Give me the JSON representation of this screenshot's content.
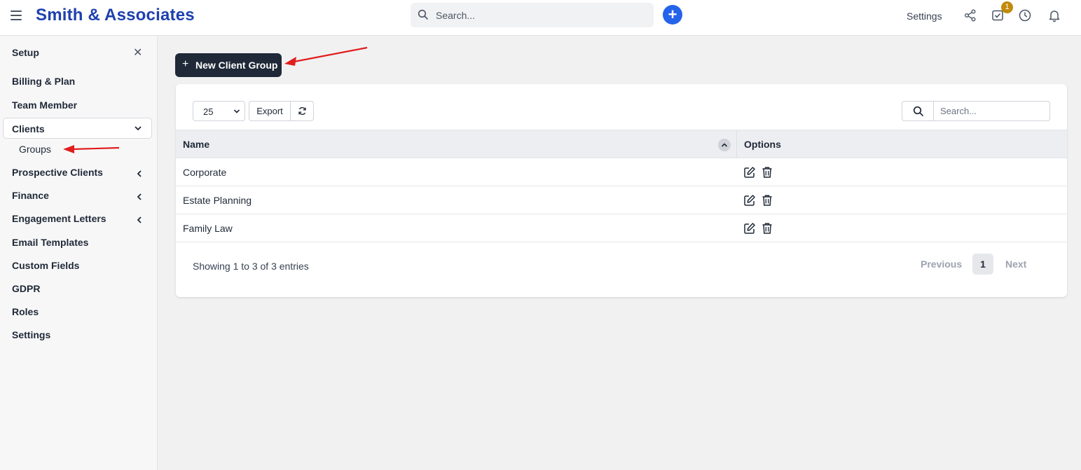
{
  "header": {
    "brand": "Smith & Associates",
    "search_placeholder": "Search...",
    "settings_label": "Settings",
    "tasks_badge": "1"
  },
  "sidebar": {
    "title": "Setup",
    "items": [
      {
        "label": "Billing & Plan"
      },
      {
        "label": "Team Member"
      },
      {
        "label": "Clients",
        "expanded": true
      },
      {
        "label": "Groups",
        "sub": true
      },
      {
        "label": "Prospective Clients"
      },
      {
        "label": "Finance"
      },
      {
        "label": "Engagement Letters"
      },
      {
        "label": "Email Templates"
      },
      {
        "label": "Custom Fields"
      },
      {
        "label": "GDPR"
      },
      {
        "label": "Roles"
      },
      {
        "label": "Settings"
      }
    ]
  },
  "main": {
    "new_button_label": "New Client Group",
    "page_length": "25",
    "export_label": "Export",
    "search_placeholder": "Search...",
    "columns": [
      "Name",
      "Options"
    ],
    "rows": [
      {
        "name": "Corporate"
      },
      {
        "name": "Estate Planning"
      },
      {
        "name": "Family Law"
      }
    ],
    "info": "Showing 1 to 3 of 3 entries",
    "pagination": {
      "previous": "Previous",
      "current": "1",
      "next": "Next"
    }
  },
  "colors": {
    "brand": "#1e40af",
    "primary_button": "#1f2937",
    "accent": "#2563eb",
    "badge": "#c28a0a",
    "annotation_arrow": "#e11d1d"
  }
}
